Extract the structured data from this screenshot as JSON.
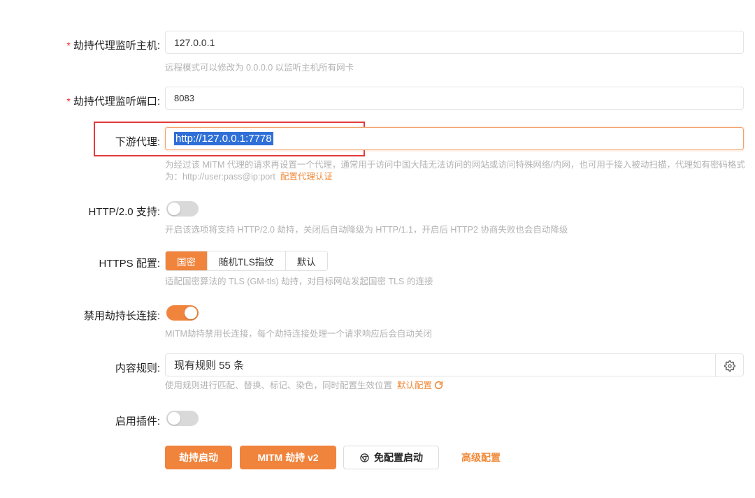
{
  "form": {
    "host": {
      "required_mark": "*",
      "label": "劫持代理监听主机:",
      "value": "127.0.0.1",
      "help": "远程模式可以修改为 0.0.0.0 以监听主机所有网卡"
    },
    "port": {
      "required_mark": "*",
      "label": "劫持代理监听端口:",
      "value": "8083"
    },
    "downstream": {
      "label": "下游代理:",
      "value": "http://127.0.0.1:7778",
      "help": "为经过该 MITM 代理的请求再设置一个代理，通常用于访问中国大陆无法访问的网站或访问特殊网络/内网，也可用于接入被动扫描，代理如有密码格式为：http://user:pass@ip:port",
      "help_link": "配置代理认证"
    },
    "http2": {
      "label": "HTTP/2.0 支持:",
      "enabled": false,
      "help": "开启该选项将支持 HTTP/2.0 劫持，关闭后自动降级为 HTTP/1.1，开启后 HTTP2 协商失败也会自动降级"
    },
    "https": {
      "label": "HTTPS 配置:",
      "options": [
        "国密",
        "随机TLS指纹",
        "默认"
      ],
      "selected": "国密",
      "help": "适配国密算法的 TLS (GM-tls) 劫持，对目标网站发起国密 TLS 的连接"
    },
    "keepalive": {
      "label": "禁用劫持长连接:",
      "enabled": true,
      "help": "MITM劫持禁用长连接，每个劫持连接处理一个请求响应后会自动关闭"
    },
    "rules": {
      "label": "内容规则:",
      "value": "现有规则 55 条",
      "help": "使用规则进行匹配、替换、标记、染色，同时配置生效位置",
      "help_link": "默认配置"
    },
    "plugins": {
      "label": "启用插件:",
      "enabled": false
    }
  },
  "actions": {
    "start": "劫持启动",
    "mitm_v2": "MITM 劫持 v2",
    "no_config": "免配置启动",
    "advanced": "高级配置"
  },
  "colors": {
    "accent": "#f0843c",
    "selection": "#2f6fd7",
    "highlight_box": "#e23b3b"
  }
}
